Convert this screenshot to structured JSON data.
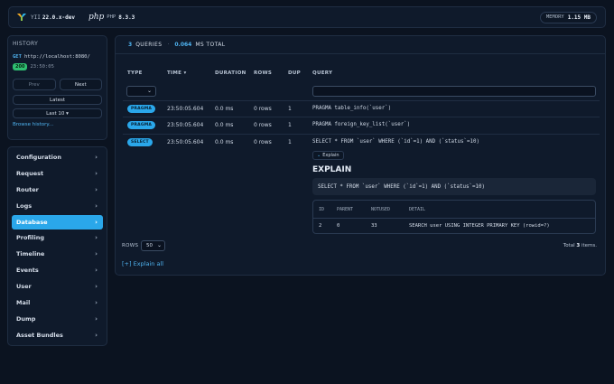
{
  "topbar": {
    "yii_label": "YII",
    "yii_version": "22.0.x-dev",
    "php_logo": "php",
    "php_label": "PHP",
    "php_version": "8.3.3",
    "memory_label": "MEMORY",
    "memory_value": "1.15 MB"
  },
  "history": {
    "title": "HISTORY",
    "method": "GET",
    "url": "http://localhost:8080/",
    "status": "200",
    "time": "23:50:05",
    "prev_label": "Prev",
    "next_label": "Next",
    "latest_label": "Latest",
    "last_label": "Last 10 ▾",
    "browse_label": "Browse history..."
  },
  "nav": {
    "items": [
      {
        "label": "Configuration",
        "active": false
      },
      {
        "label": "Request",
        "active": false
      },
      {
        "label": "Router",
        "active": false
      },
      {
        "label": "Logs",
        "active": false
      },
      {
        "label": "Database",
        "active": true
      },
      {
        "label": "Profiling",
        "active": false
      },
      {
        "label": "Timeline",
        "active": false
      },
      {
        "label": "Events",
        "active": false
      },
      {
        "label": "User",
        "active": false
      },
      {
        "label": "Mail",
        "active": false
      },
      {
        "label": "Dump",
        "active": false
      },
      {
        "label": "Asset Bundles",
        "active": false
      }
    ],
    "chevron": "›"
  },
  "main": {
    "query_count": "3",
    "queries_label": "QUERIES",
    "separator": "·",
    "total_time": "0.064",
    "ms_total_label": "MS TOTAL",
    "columns": {
      "type": "TYPE",
      "time": "TIME ▾",
      "duration": "DURATION",
      "rows": "ROWS",
      "dup": "DUP",
      "query": "QUERY"
    },
    "select_chevron": "⌄",
    "rows": [
      {
        "type": "PRAGMA",
        "time": "23:50:05.604",
        "duration": "0.0 ms",
        "rows": "0 rows",
        "dup": "1",
        "query": "PRAGMA table_info(`user`)"
      },
      {
        "type": "PRAGMA",
        "time": "23:50:05.604",
        "duration": "0.0 ms",
        "rows": "0 rows",
        "dup": "1",
        "query": "PRAGMA foreign_key_list(`user`)"
      },
      {
        "type": "SELECT",
        "time": "23:50:05.604",
        "duration": "0.0 ms",
        "rows": "0 rows",
        "dup": "1",
        "query": "SELECT * FROM `user` WHERE (`id`=1) AND (`status`=10)"
      }
    ],
    "explain": {
      "button_chevron": "⌄",
      "button_label": "Explain",
      "title": "EXPLAIN",
      "sql": "SELECT * FROM `user` WHERE (`id`=1) AND (`status`=10)",
      "headers": [
        "ID",
        "PARENT",
        "NOTUSED",
        "DETAIL"
      ],
      "row": [
        "2",
        "0",
        "33",
        "SEARCH user USING INTEGER PRIMARY KEY (rowid=?)"
      ]
    },
    "rows_label": "ROWS",
    "rows_per_page": "50",
    "total_prefix": "Total",
    "total_count": "3",
    "total_suffix": "items.",
    "explain_all_label": "[+] Explain all"
  },
  "colors": {
    "accent": "#2aa7ea",
    "background": "#0b1320",
    "panel": "#0f1a2b",
    "status_ok": "#2fbf71"
  }
}
